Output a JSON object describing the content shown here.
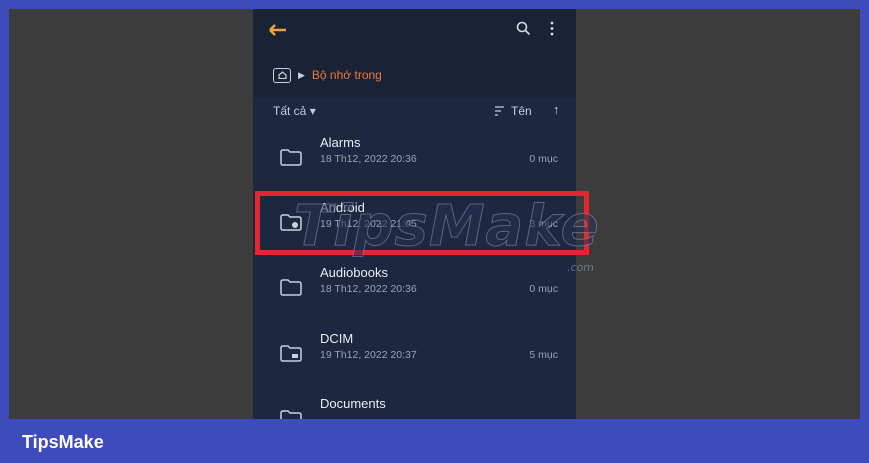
{
  "header": {
    "back_icon": "back-arrow-icon",
    "search_icon": "search-icon",
    "more_icon": "more-vert-icon"
  },
  "breadcrumb": {
    "home_icon": "home-folder-icon",
    "separator": "▶",
    "location": "Bộ nhớ trong"
  },
  "filter": {
    "label": "Tất cả",
    "caret": "▾",
    "sort_icon": "sort-icon",
    "sort_label": "Tên",
    "direction": "↑"
  },
  "files": [
    {
      "name": "Alarms",
      "date": "18 Th12, 2022 20:36",
      "count": "0 mục",
      "icon": "folder-icon"
    },
    {
      "name": "Android",
      "date": "19 Th12, 2022 21:05",
      "count": "3 mục",
      "icon": "folder-settings-icon"
    },
    {
      "name": "Audiobooks",
      "date": "18 Th12, 2022 20:36",
      "count": "0 mục",
      "icon": "folder-icon"
    },
    {
      "name": "DCIM",
      "date": "19 Th12, 2022 20:37",
      "count": "5 mục",
      "icon": "folder-camera-icon"
    },
    {
      "name": "Documents",
      "date": "",
      "count": "",
      "icon": "folder-icon"
    }
  ],
  "watermark": {
    "text": "TipsMake",
    "suffix": ".com"
  },
  "brand": {
    "label": "TipsMake"
  },
  "colors": {
    "accent": "#f07a3c",
    "highlight": "#e5252f",
    "banner": "#3d4bbd"
  }
}
